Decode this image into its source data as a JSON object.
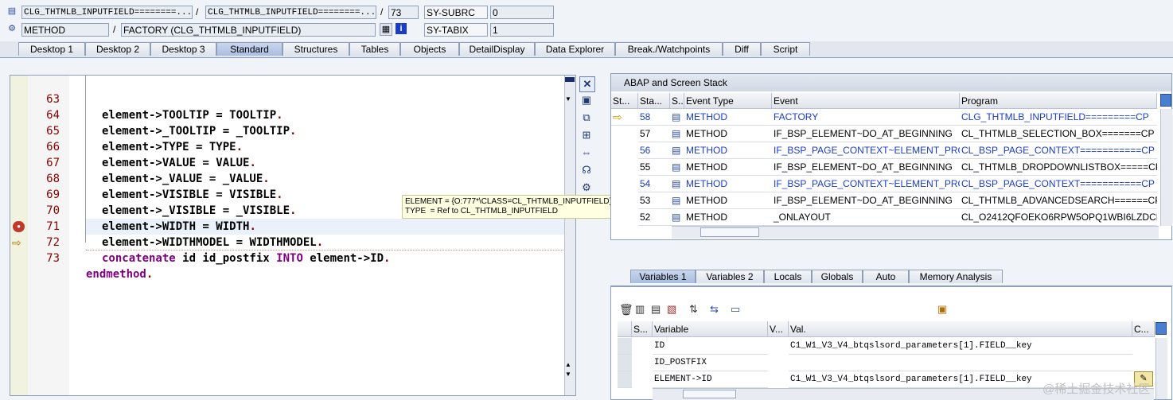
{
  "header": {
    "row1": {
      "field1": "CLG_THTMLB_INPUTFIELD========...",
      "sep1": "/",
      "field2": "CLG_THTMLB_INPUTFIELD========...",
      "sep2": "/",
      "field3": "73",
      "sysvar_name": "SY-SUBRC",
      "sysvar_value": "0"
    },
    "row2": {
      "field1": "METHOD",
      "sep1": "/",
      "field2": "FACTORY (CLG_THTMLB_INPUTFIELD)",
      "sysvar_name": "SY-TABIX",
      "sysvar_value": "1"
    }
  },
  "tabs": [
    {
      "label": "Desktop 1"
    },
    {
      "label": "Desktop 2"
    },
    {
      "label": "Desktop 3"
    },
    {
      "label": "Standard",
      "active": true
    },
    {
      "label": "Structures"
    },
    {
      "label": "Tables"
    },
    {
      "label": "Objects"
    },
    {
      "label": "DetailDisplay"
    },
    {
      "label": "Data Explorer"
    },
    {
      "label": "Break./Watchpoints"
    },
    {
      "label": "Diff"
    },
    {
      "label": "Script"
    }
  ],
  "code": {
    "lines": [
      {
        "num": "63",
        "pre": "element->",
        "mid": "TOOLTIP = TOOLTIP",
        "end": "."
      },
      {
        "num": "64",
        "pre": "element->",
        "mid": "_TOOLTIP = _TOOLTIP",
        "end": "."
      },
      {
        "num": "65",
        "pre": "element->",
        "mid": "TYPE = TYPE",
        "end": "."
      },
      {
        "num": "66",
        "pre": "element->",
        "mid": "VALUE = VALUE",
        "end": "."
      },
      {
        "num": "67",
        "pre": "element->",
        "mid": "_VALUE = _VALUE",
        "end": "."
      },
      {
        "num": "68",
        "pre": "element->",
        "mid": "VISIBLE = VISIBLE",
        "end": "."
      },
      {
        "num": "69",
        "pre": "element->",
        "mid": "_VISIBLE = _VISIBLE",
        "end": "."
      },
      {
        "num": "70",
        "pre": "element->",
        "mid": "WIDTH = WIDTH",
        "end": "."
      },
      {
        "num": "71",
        "pre": "element->",
        "mid": "WIDTHMODEL = WIDTHMODEL",
        "end": "."
      },
      {
        "num": "72",
        "kw1": "concatenate",
        "plain1": " id id_postfix ",
        "kw2": "INTO",
        "plain2": " element->ID",
        "end": "."
      },
      {
        "num": "73",
        "kw1": "endmethod",
        "end": "."
      }
    ],
    "tooltip": "ELEMENT = {O:777*\\CLASS=CL_THTMLB_INPUTFIELD}\nTYPE  = Ref to CL_THTMLB_INPUTFIELD"
  },
  "stack": {
    "title": "ABAP and Screen Stack",
    "columns": [
      "St...",
      "Sta...",
      "S...",
      "Event Type",
      "Event",
      "Program"
    ],
    "rows": [
      {
        "level": "58",
        "type": "METHOD",
        "event": "FACTORY",
        "program": "CLG_THTMLB_INPUTFIELD=========CP",
        "blue": true
      },
      {
        "level": "57",
        "type": "METHOD",
        "event": "IF_BSP_ELEMENT~DO_AT_BEGINNING",
        "program": "CL_THTMLB_SELECTION_BOX=======CP",
        "blue": false
      },
      {
        "level": "56",
        "type": "METHOD",
        "event": "IF_BSP_PAGE_CONTEXT~ELEMENT_PRO...",
        "program": "CL_BSP_PAGE_CONTEXT===========CP",
        "blue": true
      },
      {
        "level": "55",
        "type": "METHOD",
        "event": "IF_BSP_ELEMENT~DO_AT_BEGINNING",
        "program": "CL_THTMLB_DROPDOWNLISTBOX=====CP",
        "blue": false
      },
      {
        "level": "54",
        "type": "METHOD",
        "event": "IF_BSP_PAGE_CONTEXT~ELEMENT_PRO...",
        "program": "CL_BSP_PAGE_CONTEXT===========CP",
        "blue": true
      },
      {
        "level": "53",
        "type": "METHOD",
        "event": "IF_BSP_ELEMENT~DO_AT_BEGINNING",
        "program": "CL_THTMLB_ADVANCEDSEARCH======CP",
        "blue": false
      },
      {
        "level": "52",
        "type": "METHOD",
        "event": "_ONLAYOUT",
        "program": "CL_O2412QFOEKO6RPW5OPQ1WBI6LZDCP",
        "blue": false
      }
    ]
  },
  "var_tabs": [
    {
      "label": "Variables 1",
      "active": true
    },
    {
      "label": "Variables 2"
    },
    {
      "label": "Locals"
    },
    {
      "label": "Globals"
    },
    {
      "label": "Auto"
    },
    {
      "label": "Memory Analysis"
    }
  ],
  "variables": {
    "columns": [
      "S...",
      "Variable",
      "V...",
      "Val.",
      "C..."
    ],
    "rows": [
      {
        "name": "ID",
        "value": "C1_W1_V3_V4_btqslsord_parameters[1].FIELD__key"
      },
      {
        "name": "ID_POSTFIX",
        "value": ""
      },
      {
        "name": "ELEMENT->ID",
        "value": "C1_W1_V3_V4_btqslsord_parameters[1].FIELD__key"
      }
    ]
  },
  "watermark": "@稀土掘金技术社区"
}
